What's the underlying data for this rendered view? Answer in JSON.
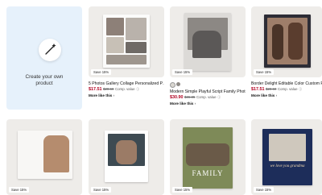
{
  "create": {
    "label": "Create your own product"
  },
  "products": [
    {
      "badge": "Save 15%",
      "title": "5 Photos Gallery Collage Personalized P…",
      "price": "$17.51",
      "old_price": "$20.60",
      "comp": "Comp. value",
      "more": "More like this"
    },
    {
      "badge": "Save 15%",
      "title": "Modern Simple Playful Script Family Phot…",
      "price": "$30.90",
      "old_price": "$36.35",
      "comp": "Comp. value",
      "more": "More like this"
    },
    {
      "badge": "Save 15%",
      "title": "Border Delight Editable Color Custom P…",
      "price": "$17.51",
      "old_price": "$20.60",
      "comp": "Comp. value",
      "more": "More like this"
    },
    {
      "badge": "Save 15%"
    },
    {
      "badge": "Save 15%"
    },
    {
      "badge": "Save 15%",
      "puzzle_text": "FAMILY"
    },
    {
      "badge": "Save 15%",
      "puzzle_text": "we love you grandma"
    }
  ],
  "colors": {
    "create_bg": "#e6f1fb",
    "tile_bg": "#eeece9",
    "price_red": "#b00020"
  },
  "icons": {
    "create": "magic-wand-icon",
    "info": "info-icon"
  }
}
